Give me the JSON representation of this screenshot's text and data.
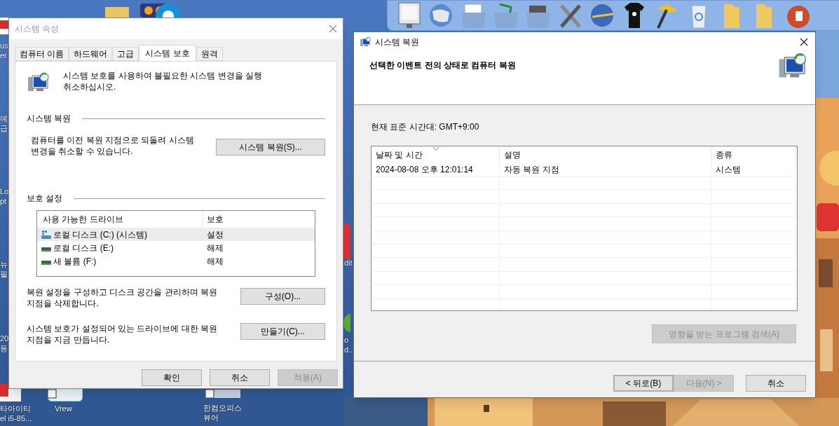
{
  "desktop_icons": [
    {
      "lines": [
        "us",
        "er"
      ]
    },
    {
      "lines": [
        "예",
        "급"
      ]
    },
    {
      "lines": [
        "Lo",
        "pt"
      ]
    },
    {
      "lines": [
        "뉴",
        "필"
      ]
    },
    {
      "lines": [
        "20",
        "동"
      ]
    },
    {
      "lines": [
        "타아이티",
        "el i5-85..."
      ]
    },
    {
      "lines": [
        "Vrew"
      ]
    },
    {
      "lines": [
        "한컴오피스",
        "뷰어"
      ]
    },
    {
      "lines": [
        "dit"
      ]
    },
    {
      "lines": [
        "o",
        "d.."
      ]
    }
  ],
  "system_properties": {
    "title": "시스템 속성",
    "tabs": [
      {
        "label": "컴퓨터 이름",
        "selected": false
      },
      {
        "label": "하드웨어",
        "selected": false
      },
      {
        "label": "고급",
        "selected": false
      },
      {
        "label": "시스템 보호",
        "selected": true
      },
      {
        "label": "원격",
        "selected": false
      }
    ],
    "intro": "시스템 보호를 사용하여 불필요한 시스템 변경을 실행 취소하십시오.",
    "restore_section": {
      "heading": "시스템 복원",
      "text": "컴퓨터를 이전 복원 지점으로 되돌려 시스템 변경을 취소할 수 있습니다.",
      "button": "시스템 복원(S)..."
    },
    "protection_section": {
      "heading": "보호 설정",
      "columns": [
        "사용 가능한 드라이브",
        "보호"
      ],
      "drives": [
        {
          "name": "로컬 디스크 (C:) (시스템)",
          "protection": "설정",
          "kind": "system",
          "selected": true
        },
        {
          "name": "로컬 디스크 (E:)",
          "protection": "해제",
          "kind": "disk",
          "selected": false
        },
        {
          "name": "새 볼륨 (F:)",
          "protection": "해제",
          "kind": "disk",
          "selected": false
        }
      ],
      "configure_text": "복원 설정을 구성하고 디스크 공간을 관리하며 복원 지점을 삭제합니다.",
      "configure_button": "구성(O)...",
      "create_text": "시스템 보호가 설정되어 있는 드라이브에 대한 복원 지점을 지금 만듭니다.",
      "create_button": "만들기(C)..."
    },
    "buttons": [
      {
        "label": "확인",
        "disabled": false
      },
      {
        "label": "취소",
        "disabled": false
      },
      {
        "label": "적용(A)",
        "disabled": true
      }
    ]
  },
  "system_restore": {
    "title": "시스템 복원",
    "heading": "선택한 이벤트 전의 상태로 컴퓨터 복원",
    "timezone": "현재 표준 시간대: GMT+9:00",
    "table": {
      "columns": [
        "날짜 및 시간",
        "설명",
        "종류"
      ],
      "rows": [
        [
          "2024-08-08 오후 12:01:14",
          "자동 복원 지점",
          "시스템"
        ]
      ]
    },
    "scan_button": {
      "label": "영향을 받는 프로그램 검색(A)",
      "disabled": true
    },
    "buttons": [
      {
        "label": "< 뒤로(B)",
        "disabled": false,
        "default": true
      },
      {
        "label": "다음(N) >",
        "disabled": true,
        "default": false
      },
      {
        "label": "취소",
        "disabled": false,
        "default": false
      }
    ]
  }
}
